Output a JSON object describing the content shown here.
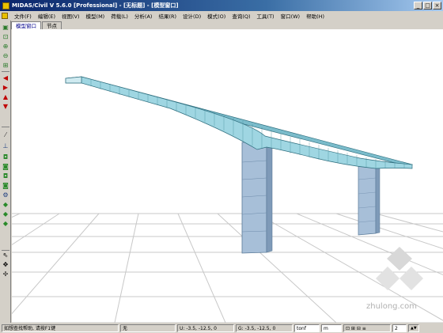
{
  "window": {
    "title": "MIDAS/Civil V 5.6.0 [Professional] - [无标题] - [模型窗口]",
    "min_label": "_",
    "max_label": "□",
    "close_label": "×"
  },
  "menubar": {
    "items": [
      "文件(F)",
      "编辑(E)",
      "视图(V)",
      "模型(M)",
      "荷载(L)",
      "分析(A)",
      "结果(R)",
      "设计(D)",
      "模式(O)",
      "查询(Q)",
      "工具(T)",
      "窗口(W)",
      "帮助(H)"
    ]
  },
  "tabs": [
    "模型窗口",
    "节点"
  ],
  "statusbar": {
    "help_text": "如想查找帮助, 请按F1键",
    "unit": "无",
    "coord_u": "U: -3.5, -12.5, 0",
    "coord_g": "G: -3.5, -12.5, 0",
    "force_unit": "tonf",
    "length_unit": "m",
    "page": "2"
  },
  "watermark": {
    "text": "zhulong.com"
  },
  "icons": {
    "toolbar": [
      "select-icon",
      "zoom-window-icon",
      "zoom-in-icon",
      "zoom-out-icon",
      "zoom-fit-icon",
      "rotate-left-icon",
      "rotate-right-icon",
      "rotate-up-icon",
      "rotate-down-icon",
      "measure-icon",
      "node-icon",
      "element-icon",
      "hidden-icon",
      "shrink-icon",
      "render-icon",
      "boundary-icon",
      "load-icon",
      "display-icon",
      "section-icon",
      "pointer-icon",
      "pan-icon",
      "move-icon"
    ]
  },
  "colors": {
    "structure": "#6fb8c9",
    "structure_dark": "#3f8c9e",
    "pier": "#a7bfd8",
    "grid": "#c8c8c8"
  }
}
